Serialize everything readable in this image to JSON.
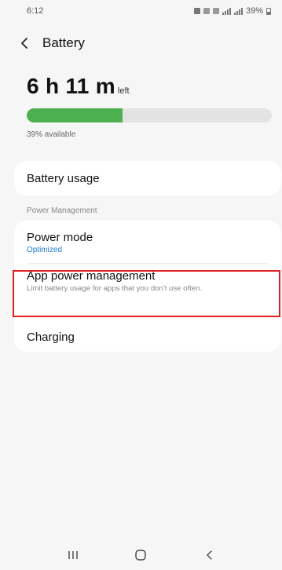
{
  "status_bar": {
    "time": "6:12",
    "battery_percent": "39%"
  },
  "header": {
    "back_icon": "chevron-left-icon",
    "title": "Battery"
  },
  "battery": {
    "time_remaining": "6 h 11 m",
    "time_suffix": "left",
    "level_percent": 39,
    "available_text": "39% available",
    "bar_color": "#4caf50"
  },
  "menu": {
    "battery_usage_label": "Battery usage",
    "section_label": "Power Management",
    "power_mode_label": "Power mode",
    "power_mode_value": "Optimized",
    "app_power_label": "App power management",
    "app_power_desc": "Limit battery usage for apps that you don't use often.",
    "charging_label": "Charging"
  },
  "nav": {
    "recents_icon": "recents-icon",
    "home_icon": "home-icon",
    "back_icon": "back-icon"
  },
  "colors": {
    "accent_blue": "#1e7bd6",
    "highlight_red": "#e02020"
  }
}
